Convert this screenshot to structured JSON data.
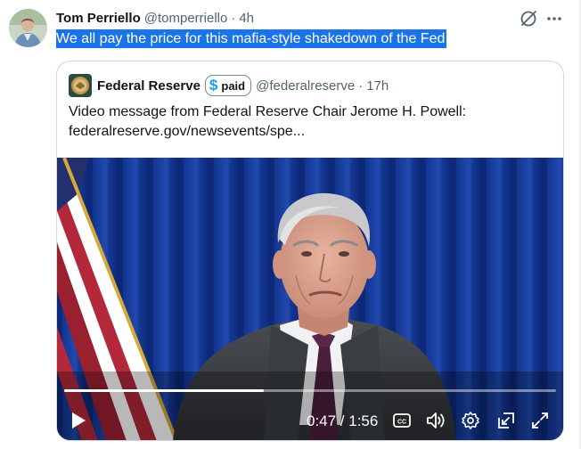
{
  "post": {
    "author_name": "Tom Perriello",
    "author_handle": "@tomperriello",
    "separator": "·",
    "time": "4h",
    "text": "We all pay the price for this mafia-style shakedown of the Fed",
    "icons": [
      "grok-icon",
      "more-icon"
    ]
  },
  "quote": {
    "name": "Federal Reserve",
    "badge_symbol": "$",
    "badge_label": "paid",
    "handle": "@federalreserve",
    "separator": "·",
    "time": "17h",
    "text_line1": "Video message from Federal Reserve Chair Jerome H. Powell:",
    "text_line2": "federalreserve.gov/newsevents/spe..."
  },
  "video": {
    "current_time": "0:47",
    "duration": "1:56",
    "time_display": "0:47 / 1:56",
    "progress": 0.405,
    "cc_label": "CC",
    "controls": [
      "play-icon",
      "closed-captions-icon",
      "volume-icon",
      "settings-icon",
      "picture-in-picture-icon",
      "fullscreen-icon"
    ]
  },
  "colors": {
    "selection": "#1a73e8",
    "secondary_text": "#536471",
    "badge_blue": "#1d9bf0",
    "border": "#cfd9de"
  }
}
